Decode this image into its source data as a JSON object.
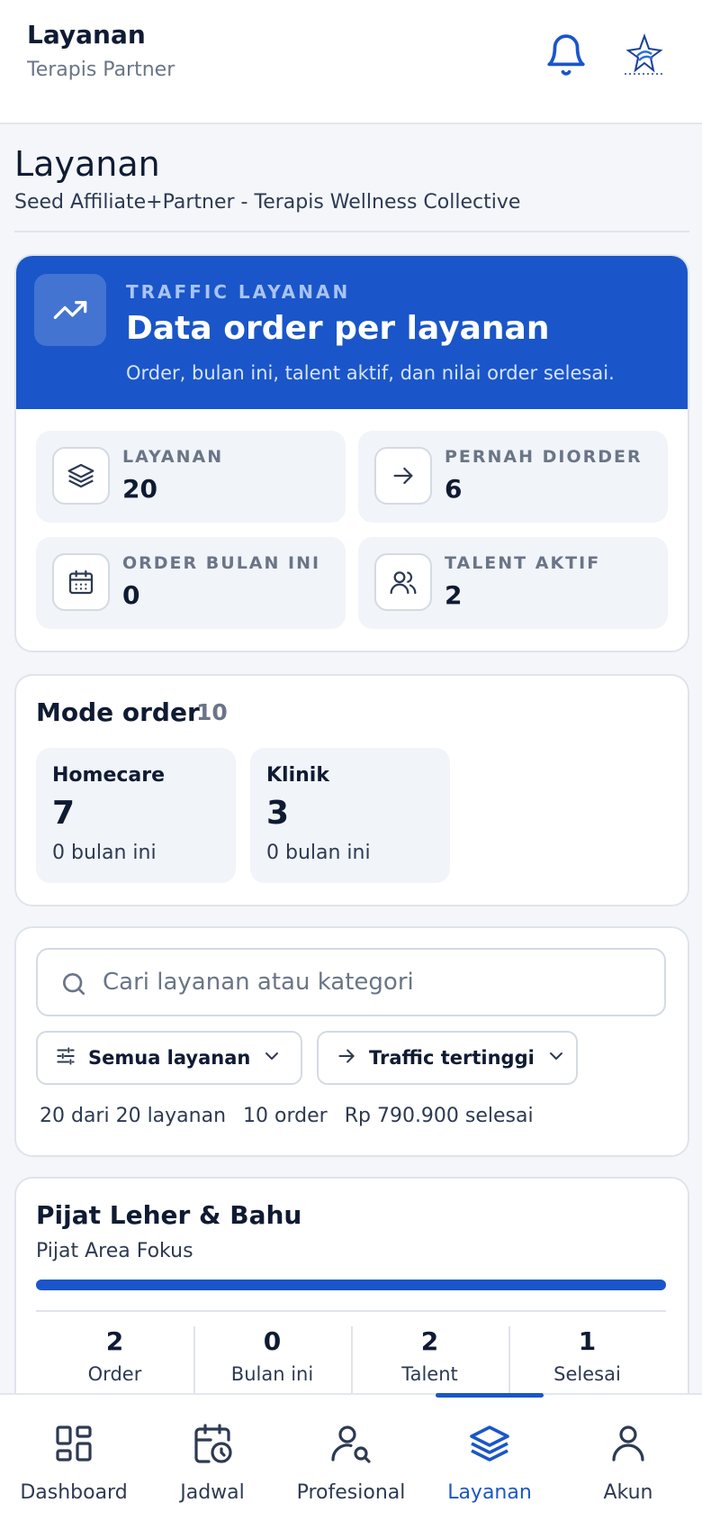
{
  "header": {
    "title": "Layanan",
    "subtitle": "Terapis Partner",
    "bell_icon": "bell-icon",
    "logo_icon": "brand-logo"
  },
  "page": {
    "title": "Layanan",
    "subtitle": "Seed Affiliate+Partner - Terapis Wellness Collective"
  },
  "traffic": {
    "eyebrow": "TRAFFIC LAYANAN",
    "title": "Data order per layanan",
    "description": "Order, bulan ini, talent aktif, dan nilai order selesai.",
    "icon": "trending-up-icon",
    "stats": [
      {
        "label": "LAYANAN",
        "value": "20",
        "icon": "layers-icon"
      },
      {
        "label": "PERNAH DIORDER",
        "value": "6",
        "icon": "arrow-right-icon"
      },
      {
        "label": "ORDER BULAN INI",
        "value": "0",
        "icon": "calendar-icon"
      },
      {
        "label": "TALENT AKTIF",
        "value": "2",
        "icon": "users-icon"
      }
    ]
  },
  "mode_order": {
    "title": "Mode order",
    "count": "10",
    "modes": [
      {
        "name": "Homecare",
        "value": "7",
        "sub": "0 bulan ini"
      },
      {
        "name": "Klinik",
        "value": "3",
        "sub": "0 bulan ini"
      }
    ]
  },
  "filters": {
    "search_placeholder": "Cari layanan atau kategori",
    "search_value": "",
    "category_filter": "Semua layanan",
    "sort_filter": "Traffic tertinggi",
    "summary": {
      "services": "20 dari 20 layanan",
      "orders": "10 order",
      "revenue": "Rp 790.900 selesai"
    }
  },
  "services": [
    {
      "name": "Pijat Leher & Bahu",
      "category": "Pijat Area Fokus",
      "progress": 1.0,
      "metrics": [
        {
          "value": "2",
          "label": "Order"
        },
        {
          "value": "0",
          "label": "Bulan ini"
        },
        {
          "value": "2",
          "label": "Talent"
        },
        {
          "value": "1",
          "label": "Selesai"
        }
      ]
    }
  ],
  "bottom_nav": {
    "active_index": 3,
    "items": [
      {
        "label": "Dashboard",
        "icon": "dashboard-icon"
      },
      {
        "label": "Jadwal",
        "icon": "calendar-clock-icon"
      },
      {
        "label": "Profesional",
        "icon": "user-search-icon"
      },
      {
        "label": "Layanan",
        "icon": "layers-icon"
      },
      {
        "label": "Akun",
        "icon": "user-icon"
      }
    ]
  },
  "colors": {
    "primary": "#1a56c9",
    "text": "#0f1b33",
    "muted": "#6a7587",
    "surface": "#f1f4f8"
  }
}
